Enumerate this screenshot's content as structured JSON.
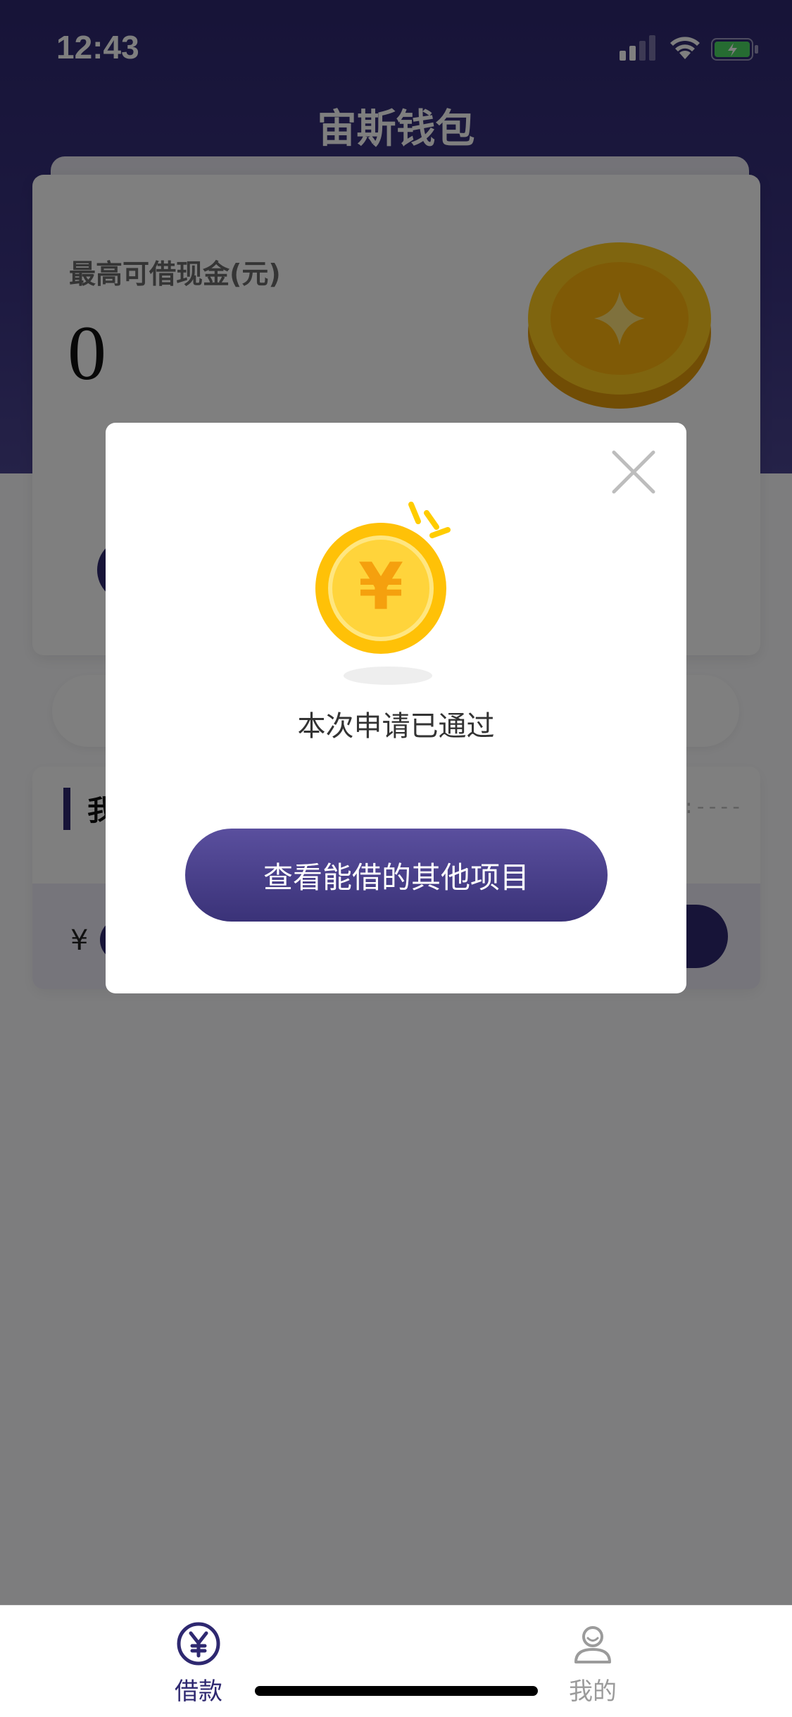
{
  "status_bar": {
    "time": "12:43"
  },
  "header": {
    "title": "宙斯钱包"
  },
  "card": {
    "label": "最高可借现金(元)",
    "amount": "0"
  },
  "list": {
    "title": "我",
    "meta": ":----",
    "currency": "¥"
  },
  "modal": {
    "message": "本次申请已通过",
    "button_label": "查看能借的其他项目",
    "coin_symbol": "¥"
  },
  "tab_bar": {
    "items": [
      {
        "label": "借款",
        "icon": "yen-circle-icon",
        "active": true
      },
      {
        "label": "我的",
        "icon": "user-icon",
        "active": false
      }
    ]
  },
  "colors": {
    "brand": "#2e2870",
    "coin": "#ffc107",
    "overlay": "rgba(0,0,0,0.5)"
  }
}
